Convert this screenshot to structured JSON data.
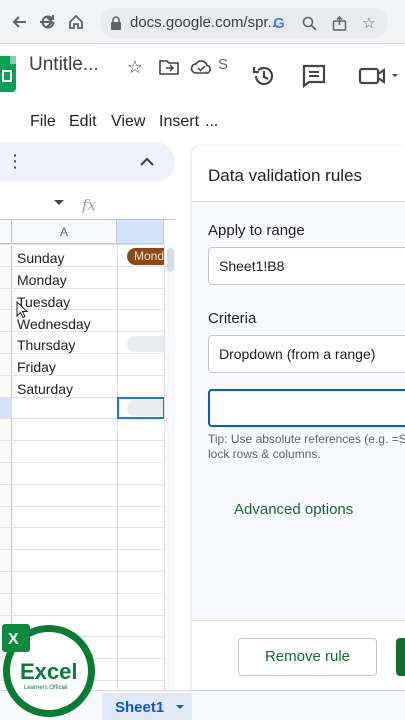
{
  "browser": {
    "url": "docs.google.com/spr..."
  },
  "doc": {
    "title": "Untitle...",
    "save_status": "S"
  },
  "menu": {
    "items": [
      "File",
      "Edit",
      "View",
      "Insert",
      "..."
    ]
  },
  "sheet": {
    "formula_icon": "fx",
    "column_header": "A",
    "cells": [
      "Sunday",
      "Monday",
      "Tuesday",
      "Wednesday",
      "Thursday",
      "Friday",
      "Saturday"
    ],
    "chip_value": "Monday",
    "tab_name": "Sheet1"
  },
  "panel": {
    "title": "Data validation rules",
    "apply_label": "Apply to range",
    "range_value": "Sheet1!B8",
    "criteria_label": "Criteria",
    "criteria_value": "Dropdown (from a range)",
    "range_input_value": "",
    "tip_line1": "Tip: Use absolute references (e.g. =S",
    "tip_line2": "lock rows & columns.",
    "advanced_label": "Advanced options",
    "remove_label": "Remove rule"
  },
  "colors": {
    "accent": "#0b57d0",
    "green": "#146c2e",
    "chip": "#8a4a1b"
  },
  "watermark": {
    "brand": "Excel",
    "sub": "Learners Official"
  }
}
